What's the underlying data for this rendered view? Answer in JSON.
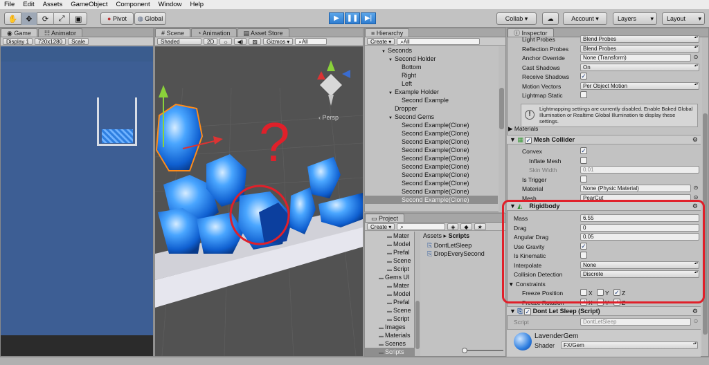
{
  "menu": [
    "File",
    "Edit",
    "Assets",
    "GameObject",
    "Component",
    "Window",
    "Help"
  ],
  "toolbar": {
    "pivot": "Pivot",
    "global": "Global",
    "collab": "Collab ▾",
    "account": "Account",
    "layers": "Layers",
    "layout": "Layout"
  },
  "game": {
    "tab": "Game",
    "tab2": "Animator",
    "display": "Display 1",
    "resolution": "720x1280",
    "scale": "Scale"
  },
  "scene": {
    "tab": "Scene",
    "tab2": "Animation",
    "tab3": "Asset Store",
    "shading": "Shaded",
    "mode2d": "2D",
    "gizmos": "Gizmos ▾",
    "search": "All",
    "persp": "‹ Persp"
  },
  "hierarchy": {
    "tab": "Hierarchy",
    "create": "Create ▾",
    "search": "All",
    "items": [
      {
        "label": "Seconds",
        "indent": 0,
        "arrow": "▼"
      },
      {
        "label": "Second Holder",
        "indent": 1,
        "arrow": "▼"
      },
      {
        "label": "Bottom",
        "indent": 2,
        "arrow": ""
      },
      {
        "label": "Right",
        "indent": 2,
        "arrow": ""
      },
      {
        "label": "Left",
        "indent": 2,
        "arrow": ""
      },
      {
        "label": "Example Holder",
        "indent": 1,
        "arrow": "▼"
      },
      {
        "label": "Second Example",
        "indent": 2,
        "arrow": ""
      },
      {
        "label": "Dropper",
        "indent": 1,
        "arrow": ""
      },
      {
        "label": "Second Gems",
        "indent": 1,
        "arrow": "▼"
      },
      {
        "label": "Second Example(Clone)",
        "indent": 2,
        "arrow": ""
      },
      {
        "label": "Second Example(Clone)",
        "indent": 2,
        "arrow": ""
      },
      {
        "label": "Second Example(Clone)",
        "indent": 2,
        "arrow": ""
      },
      {
        "label": "Second Example(Clone)",
        "indent": 2,
        "arrow": ""
      },
      {
        "label": "Second Example(Clone)",
        "indent": 2,
        "arrow": ""
      },
      {
        "label": "Second Example(Clone)",
        "indent": 2,
        "arrow": ""
      },
      {
        "label": "Second Example(Clone)",
        "indent": 2,
        "arrow": ""
      },
      {
        "label": "Second Example(Clone)",
        "indent": 2,
        "arrow": ""
      },
      {
        "label": "Second Example(Clone)",
        "indent": 2,
        "arrow": ""
      },
      {
        "label": "Second Example(Clone)",
        "indent": 2,
        "arrow": "",
        "selected": true
      }
    ]
  },
  "project": {
    "tab": "Project",
    "create": "Create ▾",
    "tree": [
      {
        "label": "Mater",
        "indent": 1
      },
      {
        "label": "Model",
        "indent": 1
      },
      {
        "label": "Prefal",
        "indent": 1
      },
      {
        "label": "Scene",
        "indent": 1
      },
      {
        "label": "Script",
        "indent": 1
      },
      {
        "label": "Gems UI",
        "indent": 0
      },
      {
        "label": "Mater",
        "indent": 1
      },
      {
        "label": "Model",
        "indent": 1
      },
      {
        "label": "Prefal",
        "indent": 1
      },
      {
        "label": "Scene",
        "indent": 1
      },
      {
        "label": "Script",
        "indent": 1
      },
      {
        "label": "Images",
        "indent": 0
      },
      {
        "label": "Materials",
        "indent": 0
      },
      {
        "label": "Scenes",
        "indent": 0
      },
      {
        "label": "Scripts",
        "indent": 0,
        "selected": true
      }
    ],
    "breadcrumb_root": "Assets",
    "breadcrumb_sep": "▸",
    "breadcrumb_current": "Scripts",
    "files": [
      "DontLetSleep",
      "DropEverySecond"
    ]
  },
  "inspector": {
    "tab": "Inspector",
    "top_rows": [
      {
        "label": "Light Probes",
        "value": "Blend Probes",
        "kind": "drop"
      },
      {
        "label": "Reflection Probes",
        "value": "Blend Probes",
        "kind": "drop"
      },
      {
        "label": "Anchor Override",
        "value": "None (Transform)",
        "kind": "obj"
      },
      {
        "label": "Cast Shadows",
        "value": "On",
        "kind": "drop"
      },
      {
        "label": "Receive Shadows",
        "value": "",
        "kind": "check",
        "checked": true
      },
      {
        "label": "Motion Vectors",
        "value": "Per Object Motion",
        "kind": "drop"
      },
      {
        "label": "Lightmap Static",
        "value": "",
        "kind": "check",
        "checked": false
      }
    ],
    "info": "Lightmapping settings are currently disabled. Enable Baked Global Illumination or Realtime Global Illumination to display these settings.",
    "materials": "Materials",
    "mesh_collider": {
      "title": "Mesh Collider",
      "convex": "Convex",
      "inflate": "Inflate Mesh",
      "skin": "Skin Width",
      "skin_value": "0.01",
      "trigger": "Is Trigger",
      "material": "Material",
      "material_value": "None (Physic Material)",
      "mesh": "Mesh",
      "mesh_value": "PearCut"
    },
    "rigidbody": {
      "title": "Rigidbody",
      "rows": [
        {
          "label": "Mass",
          "value": "6.55",
          "kind": "field"
        },
        {
          "label": "Drag",
          "value": "0",
          "kind": "field"
        },
        {
          "label": "Angular Drag",
          "value": "0.05",
          "kind": "field"
        },
        {
          "label": "Use Gravity",
          "value": "",
          "kind": "check",
          "checked": true
        },
        {
          "label": "Is Kinematic",
          "value": "",
          "kind": "check",
          "checked": false
        },
        {
          "label": "Interpolate",
          "value": "None",
          "kind": "drop"
        },
        {
          "label": "Collision Detection",
          "value": "Discrete",
          "kind": "drop"
        }
      ],
      "constraints": "Constraints",
      "freeze_pos": "Freeze Position",
      "freeze_rot": "Freeze Rotation",
      "x": "X",
      "y": "Y",
      "z": "Z",
      "pos": {
        "x": false,
        "y": false,
        "z": true
      },
      "rot": {
        "x": true,
        "y": false,
        "z": true
      }
    },
    "script": {
      "title": "Dont Let Sleep (Script)",
      "label": "Script",
      "value": "DontLetSleep"
    },
    "material": {
      "name": "LavenderGem",
      "shader_label": "Shader",
      "shader": "FX/Gem"
    }
  },
  "annotation": {
    "mark": "?",
    "color": "#e0202a"
  }
}
